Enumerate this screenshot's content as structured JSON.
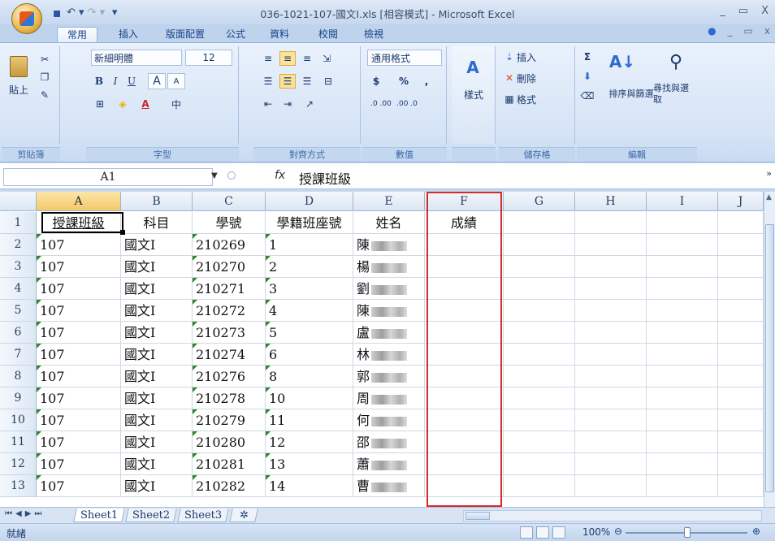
{
  "window": {
    "title": "036-1021-107-國文Ⅰ.xls [相容模式] - Microsoft Excel",
    "controls": [
      "_",
      "▭",
      "X"
    ]
  },
  "qat": {
    "save": "▪",
    "undo": "↶ ▾",
    "redo": "↷ ▾",
    "more": "▾"
  },
  "tabs": [
    "常用",
    "插入",
    "版面配置",
    "公式",
    "資料",
    "校閱",
    "檢視"
  ],
  "ribbon": {
    "clipboard": {
      "paste": "貼上",
      "label": "剪貼簿"
    },
    "font": {
      "name": "新細明體",
      "size": "12",
      "bold": "B",
      "italic": "I",
      "underline": "U",
      "grow": "A",
      "shrink": "A",
      "phonetic": "中",
      "label": "字型"
    },
    "alignment": {
      "label": "對齊方式"
    },
    "number": {
      "format": "通用格式",
      "currency": "$",
      "percent": "%",
      "comma": ",",
      "inc": ".0 .00",
      "dec": ".00 .0",
      "label": "數值"
    },
    "styles": {
      "label": "樣式"
    },
    "cells": {
      "insert": "插入",
      "delete": "刪除",
      "format": "格式",
      "label": "儲存格"
    },
    "editing": {
      "sort": "排序與篩選",
      "find": "尋找與選取",
      "label": "編輯"
    }
  },
  "formula_bar": {
    "name_box": "A1",
    "fx": "fx",
    "value": "授課班級"
  },
  "columns": [
    "A",
    "B",
    "C",
    "D",
    "E",
    "F",
    "G",
    "H",
    "I",
    "J"
  ],
  "rows": [
    {
      "num": "1",
      "a": "授課班級",
      "b": "科目",
      "c": "學號",
      "d": "學籍班座號",
      "e": "姓名",
      "f": "成績"
    },
    {
      "num": "2",
      "a": "107",
      "b": "國文Ⅰ",
      "c": "210269",
      "d": "1",
      "e": "陳"
    },
    {
      "num": "3",
      "a": "107",
      "b": "國文Ⅰ",
      "c": "210270",
      "d": "2",
      "e": "楊"
    },
    {
      "num": "4",
      "a": "107",
      "b": "國文Ⅰ",
      "c": "210271",
      "d": "3",
      "e": "劉"
    },
    {
      "num": "5",
      "a": "107",
      "b": "國文Ⅰ",
      "c": "210272",
      "d": "4",
      "e": "陳"
    },
    {
      "num": "6",
      "a": "107",
      "b": "國文Ⅰ",
      "c": "210273",
      "d": "5",
      "e": "盧"
    },
    {
      "num": "7",
      "a": "107",
      "b": "國文Ⅰ",
      "c": "210274",
      "d": "6",
      "e": "林"
    },
    {
      "num": "8",
      "a": "107",
      "b": "國文Ⅰ",
      "c": "210276",
      "d": "8",
      "e": "郭"
    },
    {
      "num": "9",
      "a": "107",
      "b": "國文Ⅰ",
      "c": "210278",
      "d": "10",
      "e": "周"
    },
    {
      "num": "10",
      "a": "107",
      "b": "國文Ⅰ",
      "c": "210279",
      "d": "11",
      "e": "何"
    },
    {
      "num": "11",
      "a": "107",
      "b": "國文Ⅰ",
      "c": "210280",
      "d": "12",
      "e": "邵"
    },
    {
      "num": "12",
      "a": "107",
      "b": "國文Ⅰ",
      "c": "210281",
      "d": "13",
      "e": "蕭"
    },
    {
      "num": "13",
      "a": "107",
      "b": "國文Ⅰ",
      "c": "210282",
      "d": "14",
      "e": "曹"
    }
  ],
  "sheets": [
    "Sheet1",
    "Sheet2",
    "Sheet3"
  ],
  "status": {
    "ready": "就緒",
    "zoom": "100%"
  }
}
